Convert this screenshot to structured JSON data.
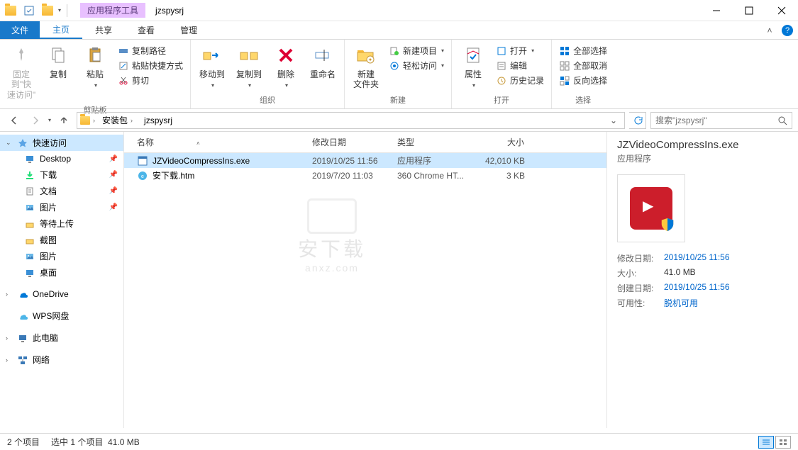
{
  "title": {
    "context_tab": "应用程序工具",
    "window_title": "jzspysrj"
  },
  "tabs": {
    "file": "文件",
    "home": "主页",
    "share": "共享",
    "view": "查看",
    "manage": "管理"
  },
  "ribbon": {
    "clipboard": {
      "pin": "固定到\"快\n速访问\"",
      "copy": "复制",
      "paste": "粘贴",
      "copy_path": "复制路径",
      "paste_shortcut": "粘贴快捷方式",
      "cut": "剪切",
      "label": "剪贴板"
    },
    "organize": {
      "move_to": "移动到",
      "copy_to": "复制到",
      "delete": "删除",
      "rename": "重命名",
      "label": "组织"
    },
    "new": {
      "new_folder": "新建\n文件夹",
      "new_item": "新建项目",
      "easy_access": "轻松访问",
      "label": "新建"
    },
    "open": {
      "properties": "属性",
      "open": "打开",
      "edit": "编辑",
      "history": "历史记录",
      "label": "打开"
    },
    "select": {
      "select_all": "全部选择",
      "select_none": "全部取消",
      "invert": "反向选择",
      "label": "选择"
    }
  },
  "breadcrumb": {
    "parts": [
      "安装包",
      "jzspysrj"
    ]
  },
  "search": {
    "placeholder": "搜索\"jzspysrj\""
  },
  "sidebar": {
    "quick_access": "快速访问",
    "items": [
      "Desktop",
      "下载",
      "文档",
      "图片",
      "等待上传",
      "截图",
      "图片",
      "桌面"
    ],
    "onedrive": "OneDrive",
    "wps": "WPS网盘",
    "this_pc": "此电脑",
    "network": "网络"
  },
  "columns": {
    "name": "名称",
    "date": "修改日期",
    "type": "类型",
    "size": "大小"
  },
  "files": [
    {
      "name": "JZVideoCompressIns.exe",
      "date": "2019/10/25 11:56",
      "type": "应用程序",
      "size": "42,010 KB",
      "selected": true,
      "icon": "exe"
    },
    {
      "name": "安下载.htm",
      "date": "2019/7/20 11:03",
      "type": "360 Chrome HT...",
      "size": "3 KB",
      "selected": false,
      "icon": "htm"
    }
  ],
  "details": {
    "name": "JZVideoCompressIns.exe",
    "type": "应用程序",
    "rows": [
      {
        "label": "修改日期:",
        "value": "2019/10/25 11:56",
        "link": true
      },
      {
        "label": "大小:",
        "value": "41.0 MB",
        "link": false
      },
      {
        "label": "创建日期:",
        "value": "2019/10/25 11:56",
        "link": true
      },
      {
        "label": "可用性:",
        "value": "脱机可用",
        "link": true
      }
    ]
  },
  "status": {
    "count": "2 个项目",
    "selected": "选中 1 个项目",
    "size": "41.0 MB"
  },
  "watermark": {
    "text": "安下载",
    "sub": "anxz.com"
  }
}
